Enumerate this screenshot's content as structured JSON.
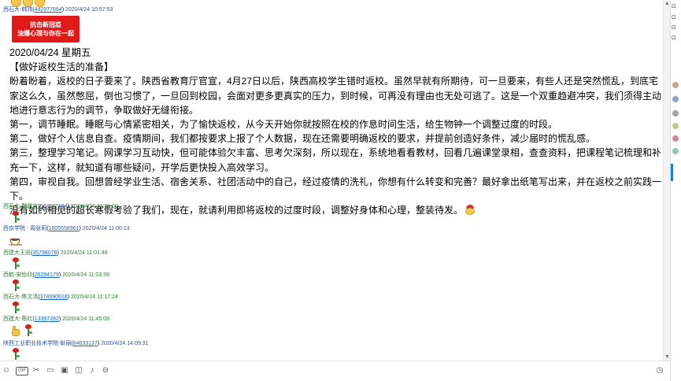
{
  "top_message": {
    "sender": "西石大-韩玮",
    "qq": "442977664",
    "time": "2020/4/24 10:57:53"
  },
  "poster": {
    "line1": "抗击新冠疫",
    "line2": "油爆心理与你在一起"
  },
  "post": {
    "date": "2020/04/24 星期五",
    "title": "【做好返校生活的准备】",
    "paragraphs": [
      "盼着盼着，返校的日子要来了。陕西省教育厅官宣，4月27日以后，陕西高校学生错时返校。虽然早就有所期待，可一旦要来，有些人还是突然慌乱，到底宅家这么久，虽然憋屈，倒也习惯了，一旦回到校园，会面对更多更真实的压力，到时候，可再没有理由也无处可逃了。这是一个双重趋避冲突，我们须得主动地进行意志行为的调节，争取做好无缝衔接。",
      "第一，调节睡眠。睡眠与心情紧密相关，为了愉快返校，从今天开始你就按照在校的作息时间生活，给生物钟一个调整过度的时段。",
      "第二，做好个人信息自查。疫情期间，我们都按要求上报了个人数据，现在还需要明确返校的要求，并提前创造好条件，减少届时的慌乱感。",
      "第三，整理学习笔记。网课学习互动快，但可能体验欠丰富、思考欠深刻，所以现在，系统地看看教材，回看几遍课堂录相，查查资料，把课程笔记梳理和补充一下，这样，就知道有哪些疑问，开学后更快投入高效学习。",
      "第四，审视自我。回想曾经学业生活、宿舍关系、社团活动中的自己，经过疫情的洗礼，你想有什么转变和完善？最好拿出纸笔写出来，并在返校之前实践一下。",
      "没有如约相见的超长寒假考验了我们，现在，就请利用即将返校的过度时段，调整好身体和心理，整装待发。"
    ]
  },
  "replies": [
    {
      "sender": "西石大-魏晓宣",
      "qq": "584937194",
      "time": "2020/4/24 11:00:00",
      "emoji": "rose-icon"
    },
    {
      "sender": "西京学院 - 周张莉",
      "qq": "1605558961",
      "time": "2020/4/24 11:00:13",
      "emoji": "coffee-icon"
    },
    {
      "sender": "西建大王凯",
      "qq": "35798078",
      "time": "2020/4/24 11:01:48",
      "emoji": "rose-icon"
    },
    {
      "sender": "西航-安怡欣",
      "qq": "26294179",
      "time": "2020/4/24 11:03:39",
      "emoji": "rose-icon"
    },
    {
      "sender": "西石大-焦文清",
      "qq": "374990618",
      "time": "2020/4/24 11:17:24",
      "emoji": "rose-icon"
    },
    {
      "sender": "西建大-陈红",
      "qq": "13397282",
      "time": "2020/4/24 11:45:09",
      "emoji": "thumb-rose"
    },
    {
      "sender": "陕西工业职业技术学院-耿丽",
      "qq": "84633137",
      "time": "2020/4/24 14:09:31",
      "emoji": "rose-icon"
    }
  ],
  "toolbar": {
    "gif_label": "GIF"
  },
  "colors": {
    "sender_green": "#2e7d32",
    "qq_blue": "#1565c0",
    "poster_red": "#e01919",
    "side_accent": "#1c7ed6"
  }
}
